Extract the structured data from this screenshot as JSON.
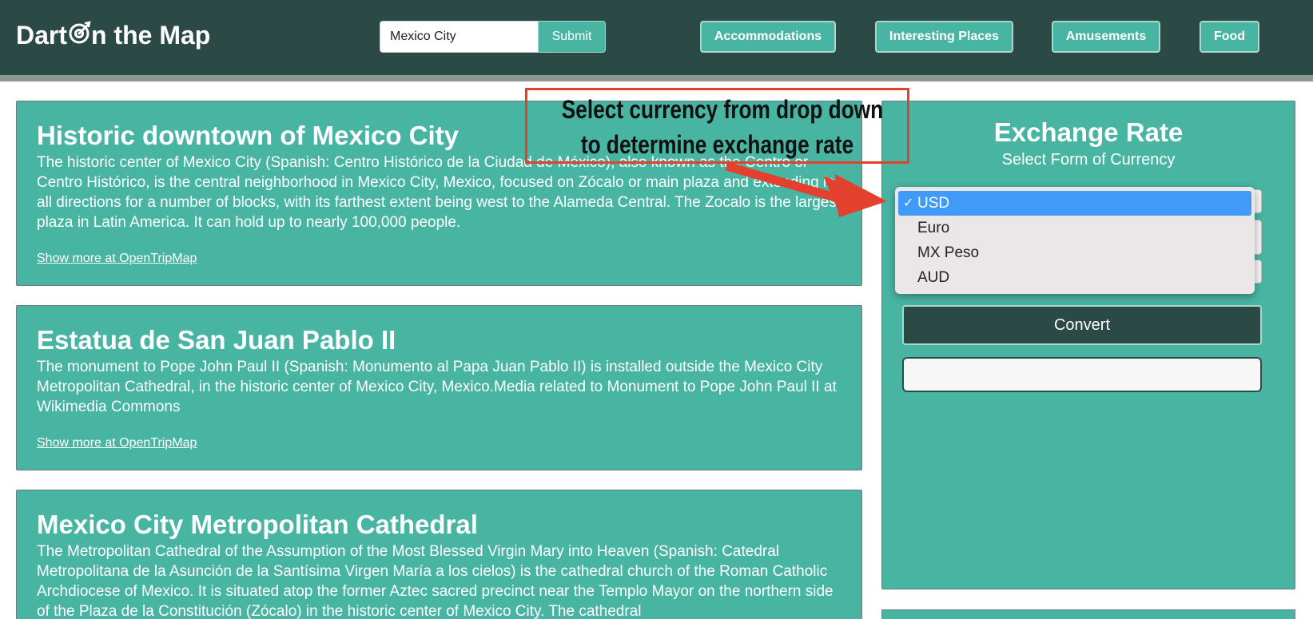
{
  "header": {
    "brand_prefix": "Dart ",
    "brand_suffix": "n the Map",
    "brand_icon": "dart-target-icon",
    "search_value": "Mexico City",
    "submit_label": "Submit",
    "nav": [
      "Accommodations",
      "Interesting Places",
      "Amusements",
      "Food"
    ]
  },
  "places": [
    {
      "title": "Historic downtown of Mexico City",
      "description": "The historic center of Mexico City (Spanish: Centro Histórico de la Ciudad de México), also known as the Centro or Centro Histórico, is the central neighborhood in Mexico City, Mexico, focused on Zócalo or main plaza and extending in all directions for a number of blocks, with its farthest extent being west to the Alameda Central. The Zocalo is the largest plaza in Latin America. It can hold up to nearly 100,000 people.",
      "link": "Show more at OpenTripMap"
    },
    {
      "title": "Estatua de San Juan Pablo II",
      "description": "The monument to Pope John Paul II (Spanish: Monumento al Papa Juan Pablo II) is installed outside the Mexico City Metropolitan Cathedral, in the historic center of Mexico City, Mexico.Media related to Monument to Pope John Paul II at Wikimedia Commons",
      "link": "Show more at OpenTripMap"
    },
    {
      "title": "Mexico City Metropolitan Cathedral",
      "description": "The Metropolitan Cathedral of the Assumption of the Most Blessed Virgin Mary into Heaven (Spanish: Catedral Metropolitana de la Asunción de la Santísima Virgen María a los cielos) is the cathedral church of the Roman Catholic Archdiocese of Mexico. It is situated atop the former Aztec sacred precinct near the Templo Mayor on the northern side of the Plaza de la Constitución (Zócalo) in the historic center of Mexico City. The cathedral",
      "link": "Show more at OpenTripMap"
    }
  ],
  "exchange": {
    "title": "Exchange Rate",
    "subtitle": "Select Form of Currency",
    "options": [
      "USD",
      "Euro",
      "MX Peso",
      "AUD"
    ],
    "selected": "USD",
    "check_mark": "✓",
    "convert_label": "Convert",
    "result_value": ""
  },
  "annotation": {
    "line1": "Select currency from drop down",
    "line2": "to determine exchange rate"
  },
  "colors": {
    "header_bg": "#2c4a45",
    "card_bg": "#48b4a2",
    "selected_option": "#3f9bf7",
    "annotation": "#e4402e"
  }
}
